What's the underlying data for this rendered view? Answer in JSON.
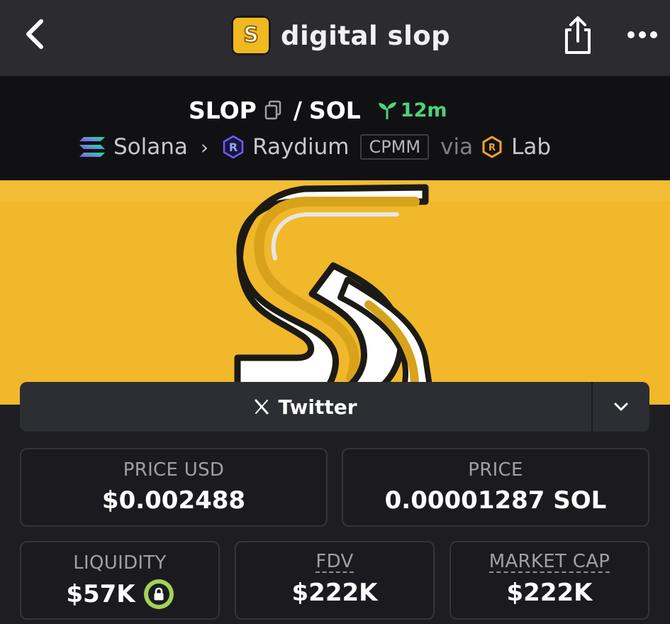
{
  "header": {
    "title": "digital slop",
    "logo_letter": "S",
    "back_icon": "chevron-left-icon",
    "share_icon": "share-icon",
    "more_icon": "more-horizontal-icon"
  },
  "pair": {
    "base": "SLOP",
    "separator": "/",
    "quote": "SOL",
    "age": "12m",
    "chain": "Solana",
    "dex": "Raydium",
    "pool_type": "CPMM",
    "via_label": "via",
    "launchpad": "Lab"
  },
  "social": {
    "label": "Twitter"
  },
  "stats": {
    "price_usd": {
      "label": "PRICE USD",
      "value": "$0.002488"
    },
    "price": {
      "label": "PRICE",
      "value": "0.00001287 SOL"
    },
    "liquidity": {
      "label": "LIQUIDITY",
      "value": "$57K"
    },
    "fdv": {
      "label": "FDV",
      "value": "$222K"
    },
    "market_cap": {
      "label": "MARKET CAP",
      "value": "$222K"
    }
  },
  "colors": {
    "accent_yellow": "#f0b82a",
    "age_green": "#4fd27a",
    "lock_green": "#a4d257"
  }
}
